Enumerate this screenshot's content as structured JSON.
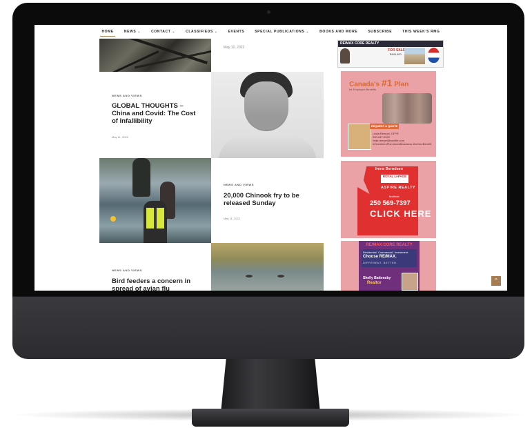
{
  "nav": {
    "items": [
      {
        "label": "HOME",
        "dropdown": false,
        "active": true
      },
      {
        "label": "NEWS",
        "dropdown": true,
        "active": false
      },
      {
        "label": "CONTACT",
        "dropdown": true,
        "active": false
      },
      {
        "label": "CLASSIFIEDS",
        "dropdown": true,
        "active": false
      },
      {
        "label": "EVENTS",
        "dropdown": false,
        "active": false
      },
      {
        "label": "SPECIAL PUBLICATIONS",
        "dropdown": true,
        "active": false
      },
      {
        "label": "BOOKS AND MORE",
        "dropdown": false,
        "active": false
      },
      {
        "label": "SUBSCRIBE",
        "dropdown": false,
        "active": false
      },
      {
        "label": "THIS WEEK'S RMG",
        "dropdown": false,
        "active": false
      }
    ],
    "caret_glyph": "⌄"
  },
  "top_post": {
    "date": "May 12, 2022"
  },
  "articles": [
    {
      "category": "NEWS AND VIEWS",
      "title": "GLOBAL THOUGHTS – China and Covid: The Cost of Infallibility",
      "date": "May 11, 2022"
    },
    {
      "category": "NEWS AND VIEWS",
      "title": "20,000 Chinook fry to be released Sunday",
      "date": "May 11, 2022"
    },
    {
      "category": "NEWS AND VIEWS",
      "title": "Bird feeders a concern in spread of avian flu",
      "date": ""
    }
  ],
  "ads": {
    "remax_top": {
      "brand": "RE/MAX CORE REALTY",
      "tag": "FOR SALE",
      "price": "$449,000"
    },
    "canada_plan": {
      "headline_pre": "Canada's",
      "headline_num": "#1",
      "headline_post": "Plan",
      "subhead": "for Employee Benefits",
      "cta": "REQUEST A QUOTE",
      "contact": "Linda Rempel, CFP®\n250-617-2929\nlinda.rempel@sunlife.com\n#ChambersPlan #smallbusiness #bsYourBenefit"
    },
    "berndsen": {
      "name": "Irene Berndsen",
      "brokerage": "ROYAL LePAGE",
      "office": "ASPIRE REALTY",
      "city": "McBride",
      "phone": "250 569-7397",
      "cta": "CLICK HERE"
    },
    "remax_bottom": {
      "brand": "RE/MAX CORE REALTY",
      "line1": "Residential. Commercial. Investment.",
      "line2": "Choose RE/MAX.",
      "line3": "DIFFERENT. BETTER.",
      "agent": "Shelly Battensby",
      "title": "Realtor"
    }
  },
  "ui": {
    "back_to_top_glyph": "⌃"
  },
  "colors": {
    "accent": "#a67c52",
    "ad_bg": "#eaa2a6",
    "berndsen_red": "#e0302f",
    "remax_purple": "#6f2f7a"
  }
}
